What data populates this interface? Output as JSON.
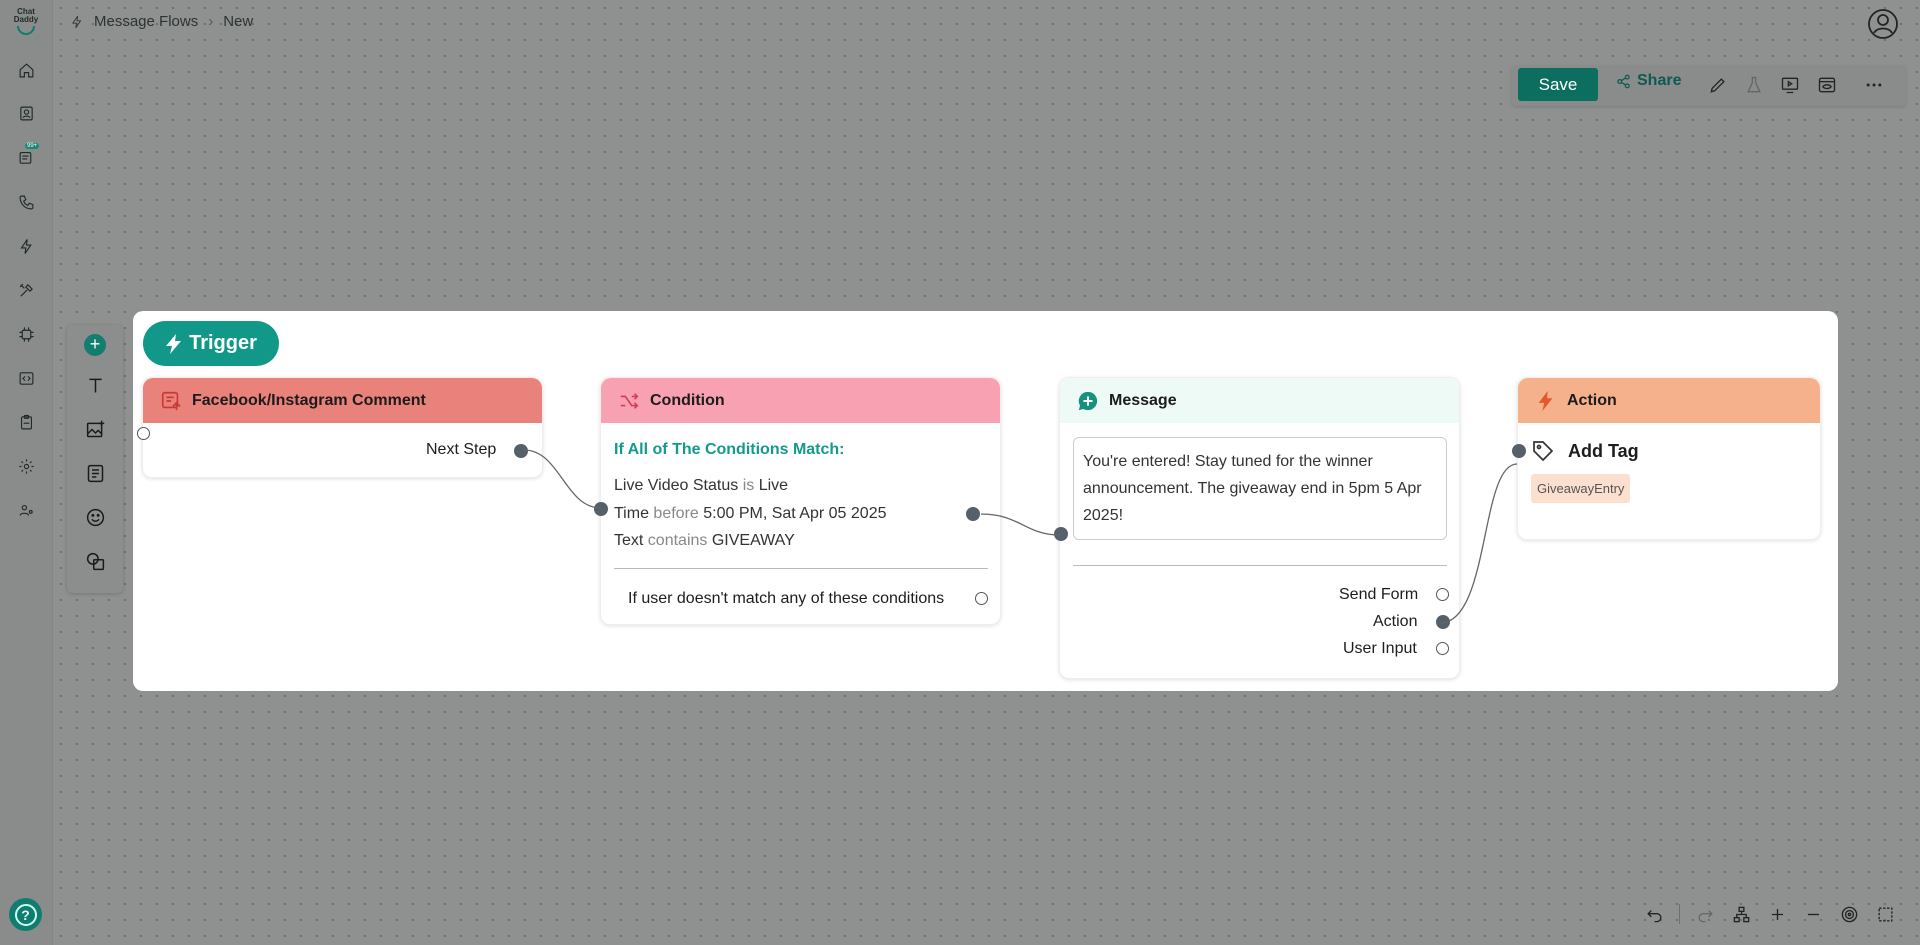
{
  "app": {
    "logo_text_1": "Chat",
    "logo_text_2": "Daddy",
    "badge": "99+"
  },
  "breadcrumb": {
    "parent": "Message Flows",
    "current": "New"
  },
  "toolbar": {
    "save_label": "Save",
    "share_label": "Share"
  },
  "trigger": {
    "label": "Trigger"
  },
  "nodes": {
    "comment": {
      "title": "Facebook/Instagram Comment",
      "next_step": "Next Step"
    },
    "condition": {
      "title": "Condition",
      "heading": "If All of The Conditions Match:",
      "rules": [
        {
          "field": "Live Video Status",
          "op": "is",
          "value": "Live"
        },
        {
          "field": "Time",
          "op": "before",
          "value": "5:00 PM, Sat Apr 05 2025"
        },
        {
          "field": "Text",
          "op": "contains",
          "value": "GIVEAWAY"
        }
      ],
      "fallback": "If user doesn't match any of these conditions"
    },
    "message": {
      "title": "Message",
      "text": "You're entered! Stay tuned for the winner announcement. The giveaway end in 5pm 5 Apr 2025!",
      "outputs": [
        "Send Form",
        "Action",
        "User Input"
      ]
    },
    "action": {
      "title": "Action",
      "subtitle": "Add Tag",
      "tag": "GiveawayEntry"
    }
  },
  "colors": {
    "accent": "#0b6e5f",
    "trigger": "#129889",
    "comment_header": "#e8827a",
    "condition_header": "#f7a1b2",
    "message_header": "#eefaf6",
    "action_header": "#f5b08c"
  }
}
